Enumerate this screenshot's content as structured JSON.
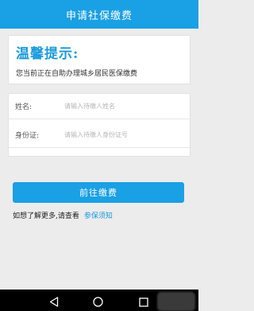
{
  "header": {
    "title": "申请社保缴费"
  },
  "notice": {
    "title": "温馨提示:",
    "text": "您当前正在自助办理城乡居民医保缴费"
  },
  "form": {
    "name_label": "姓名:",
    "name_placeholder": "请输入待缴人姓名",
    "id_label": "身份证:",
    "id_placeholder": "请输入待缴人身份证号"
  },
  "actions": {
    "submit_label": "前往缴费"
  },
  "more_info": {
    "prefix": "如想了解更多,请查看",
    "link_label": "参保须知"
  },
  "colors": {
    "primary": "#1aa0e4",
    "link": "#1a9bdc"
  },
  "nav_bar": {
    "icons": [
      "back-icon",
      "home-icon",
      "recent-apps-icon"
    ]
  }
}
